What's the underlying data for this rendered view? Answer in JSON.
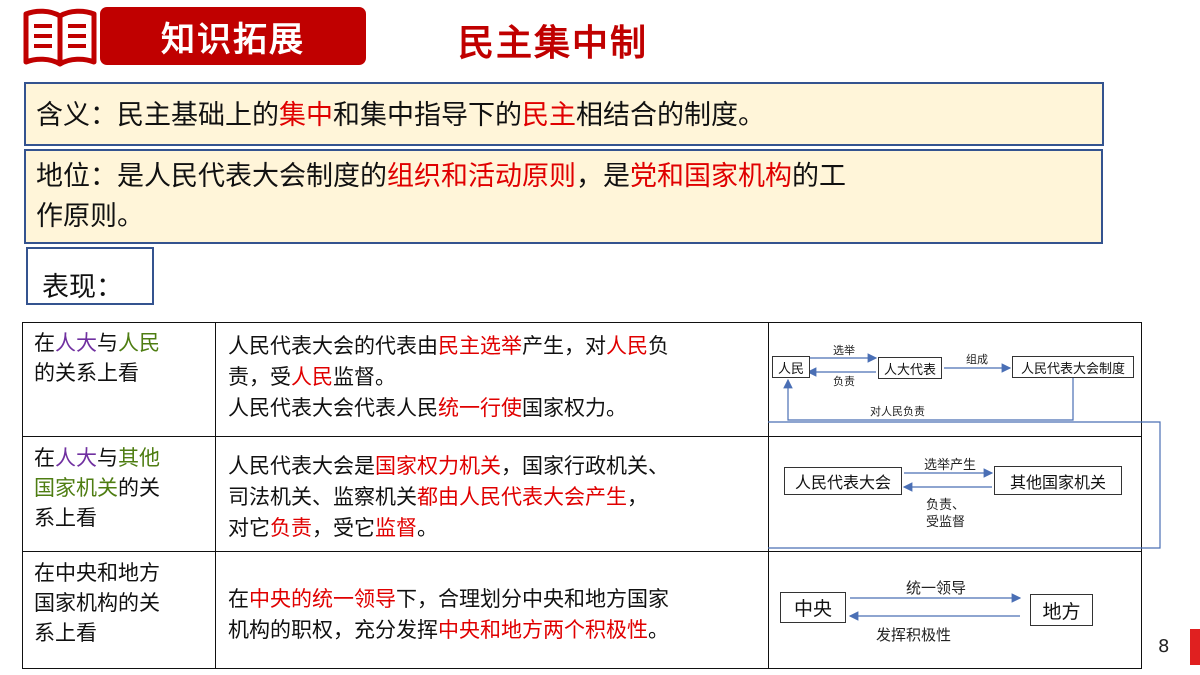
{
  "header": {
    "badge": "知识拓展",
    "title": "民主集中制"
  },
  "meaning": {
    "p1": "含义：民主基础上的",
    "h1": "集中",
    "p2": "和集中指导下的",
    "h2": "民主",
    "p3": "相结合的制度。"
  },
  "status": {
    "p1": "地位：是人民代表大会制度的",
    "h1": "组织和活动原则",
    "p2": "，是",
    "h2": "党和国家机构",
    "p3": "的工",
    "p4": "作原则。"
  },
  "biaoxian": "表现：",
  "rows": [
    {
      "left": {
        "a": "在",
        "b": "人大",
        "c": "与",
        "d": "人民",
        "e": "的关系上看"
      },
      "mid": {
        "l1a": "人民代表大会的代表由",
        "l1b": "民主选举",
        "l1c": "产生，对",
        "l1d": "人民",
        "l1e": "负",
        "l2a": "责，受",
        "l2b": "人民",
        "l2c": "监督。",
        "l3a": "人民代表大会代表人民",
        "l3b": "统一行使",
        "l3c": "国家权力。"
      },
      "diagram": {
        "box_people": "人民",
        "box_deputies": "人大代表",
        "box_system": "人民代表大会制度",
        "lbl_elect": "选举",
        "lbl_resp": "负责",
        "lbl_form": "组成",
        "lbl_to_people": "对人民负责"
      }
    },
    {
      "left": {
        "a": "在",
        "b": "人大",
        "c": "与",
        "d": "其他",
        "e": "国家机关",
        "f": "的关",
        "g": "系上看"
      },
      "mid": {
        "l1a": "人民代表大会是",
        "l1b": "国家权力机关",
        "l1c": "，国家行政机关、",
        "l2a": "司法机关、监察机关",
        "l2b": "都由人民代表大会产生",
        "l2c": "，",
        "l3a": "对它",
        "l3b": "负责",
        "l3c": "，受它",
        "l3d": "监督",
        "l3e": "。"
      },
      "diagram": {
        "box_npc": "人民代表大会",
        "box_other": "其他国家机关",
        "lbl_elect": "选举产生",
        "lbl_resp1": "负责、",
        "lbl_resp2": "受监督"
      }
    },
    {
      "left": {
        "a": "在中央和地方",
        "b": "国家机构的关",
        "c": "系上看"
      },
      "mid": {
        "l1a": "在",
        "l1b": "中央的统一领导",
        "l1c": "下，合理划分中央和地方国家",
        "l2a": "机构的职权，充分发挥",
        "l2b": "中央和地方两个积极性",
        "l2c": "。"
      },
      "diagram": {
        "box_central": "中央",
        "box_local": "地方",
        "lbl_lead": "统一领导",
        "lbl_play": "发挥积极性"
      }
    }
  ],
  "page_number": "8",
  "colors": {
    "brand_red": "#c00000",
    "highlight_red": "#e00000",
    "purple": "#7030a0",
    "green": "#4e7d12",
    "box_bg": "#fff5d9",
    "box_border": "#34538f"
  }
}
